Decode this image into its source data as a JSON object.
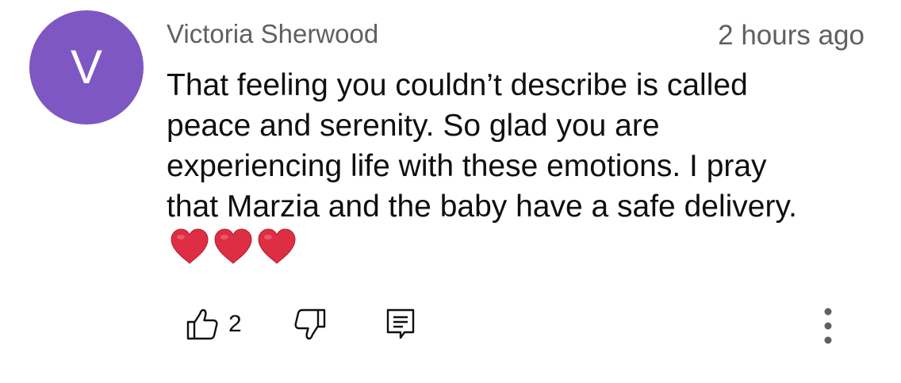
{
  "comment": {
    "avatar_letter": "V",
    "avatar_color": "#7e57c2",
    "author": "Victoria Sherwood",
    "timestamp": "2 hours ago",
    "text": "That feeling you couldn’t describe is called\npeace and serenity. So glad you are\nexperiencing life with these emotions. I pray\nthat Marzia and the baby have a safe delivery.",
    "emoji": [
      "red-heart",
      "red-heart",
      "red-heart"
    ]
  },
  "actions": {
    "like_icon": "thumbs-up-icon",
    "like_count": "2",
    "dislike_icon": "thumbs-down-icon",
    "reply_icon": "reply-icon",
    "menu_icon": "more-vertical-icon"
  }
}
